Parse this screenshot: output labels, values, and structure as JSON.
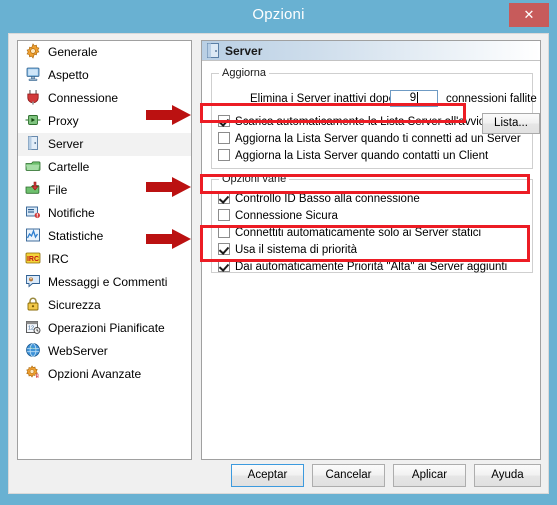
{
  "window": {
    "title": "Opzioni",
    "close_label": "✕",
    "accent_titlebar": "#69b1d2",
    "accent_close": "#c75b5b",
    "annotation_color": "#ec1c24",
    "arrow_color": "#bb1111"
  },
  "sidebar": {
    "items": [
      {
        "label": "Generale",
        "icon": "gear-icon",
        "selected": false
      },
      {
        "label": "Aspetto",
        "icon": "monitor-icon",
        "selected": false
      },
      {
        "label": "Connessione",
        "icon": "plug-icon",
        "selected": false
      },
      {
        "label": "Proxy",
        "icon": "proxy-icon",
        "selected": false
      },
      {
        "label": "Server",
        "icon": "server-icon",
        "selected": true
      },
      {
        "label": "Cartelle",
        "icon": "folder-icon",
        "selected": false
      },
      {
        "label": "File",
        "icon": "file-download-icon",
        "selected": false
      },
      {
        "label": "Notifiche",
        "icon": "notification-icon",
        "selected": false
      },
      {
        "label": "Statistiche",
        "icon": "statistics-icon",
        "selected": false
      },
      {
        "label": "IRC",
        "icon": "irc-icon",
        "selected": false
      },
      {
        "label": "Messaggi e Commenti",
        "icon": "message-icon",
        "selected": false
      },
      {
        "label": "Sicurezza",
        "icon": "lock-icon",
        "selected": false
      },
      {
        "label": "Operazioni Pianificate",
        "icon": "calendar-clock-icon",
        "selected": false
      },
      {
        "label": "WebServer",
        "icon": "globe-icon",
        "selected": false
      },
      {
        "label": "Opzioni Avanzate",
        "icon": "advanced-gear-icon",
        "selected": false
      }
    ]
  },
  "panel": {
    "header_title": "Server",
    "header_icon": "server-icon",
    "group_aggiorna": {
      "legend": "Aggiorna",
      "elimina_prefix": "Elimina i Server inattivi dopo",
      "elimina_value": "9",
      "elimina_suffix": "connessioni fallite",
      "lista_button": "Lista...",
      "checkboxes": [
        {
          "label": "Scarica automaticamente la Lista Server all'avvio",
          "checked": true
        },
        {
          "label": "Aggiorna la Lista Server quando ti connetti ad un Server",
          "checked": false
        },
        {
          "label": "Aggiorna la Lista Server quando contatti un Client",
          "checked": false
        }
      ]
    },
    "group_varie": {
      "legend": "Opzioni varie",
      "checkboxes": [
        {
          "label": "Controllo ID Basso alla connessione",
          "checked": true
        },
        {
          "label": "Connessione Sicura",
          "checked": false
        },
        {
          "label": "Connettiti automaticamente solo ai Server statici",
          "checked": false
        },
        {
          "label": "Usa il sistema di priorità",
          "checked": true
        },
        {
          "label": "Dai automaticamente Priorità \"Alta\" ai Server aggiunti",
          "checked": true
        }
      ]
    }
  },
  "buttons": {
    "ok": "Aceptar",
    "cancel": "Cancelar",
    "apply": "Aplicar",
    "help": "Ayuda"
  }
}
